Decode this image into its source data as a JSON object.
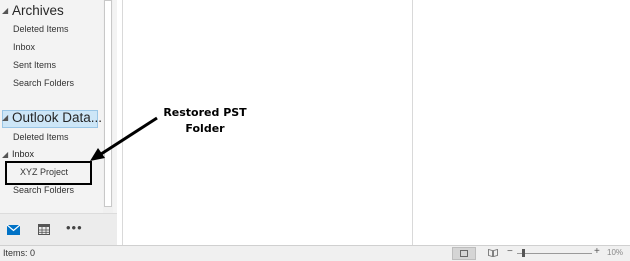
{
  "folder_pane": {
    "archives": {
      "header": "Archives",
      "items": [
        "Deleted Items",
        "Inbox",
        "Sent Items",
        "Search Folders"
      ]
    },
    "outlook_data": {
      "header": "Outlook Data...",
      "deleted_items": "Deleted Items",
      "inbox": "Inbox",
      "xyz_project": "XYZ Project",
      "search_folders": "Search Folders"
    }
  },
  "nav_bar": {
    "mail_icon": "mail-icon",
    "calendar_icon": "calendar-icon",
    "more_label": "•••"
  },
  "annotation": {
    "line1": "Restored PST",
    "line2": "Folder"
  },
  "status_bar": {
    "items_label": "Items: 0",
    "zoom_minus": "−",
    "zoom_plus": "+",
    "zoom_level": "10%"
  },
  "colors": {
    "accent": "#0078d7",
    "selection": "#cde6f7"
  }
}
